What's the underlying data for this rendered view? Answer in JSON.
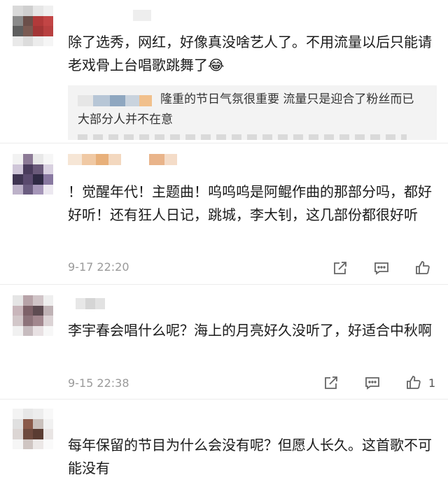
{
  "comments": [
    {
      "text": "除了选秀，网红，好像真没啥艺人了。不用流量以后只能请老戏骨上台唱歌跳舞了😂",
      "reply_quote": {
        "text": "隆重的节日气氛很重要 流量只是迎合了粉丝而已 大部分人并不在意"
      }
    },
    {
      "text": "！觉醒年代！主题曲！呜呜呜是阿鲲作曲的那部分吗，都好好听！还有狂人日记，跳城，李大钊，这几部份都很好听",
      "time": "9-17 22:20",
      "likes": ""
    },
    {
      "text": "李宇春会唱什么呢？海上的月亮好久没听了，好适合中秋啊",
      "time": "9-15 22:38",
      "likes": "1"
    },
    {
      "text": "每年保留的节目为什么会没有呢？但愿人长久。这首歌不可能没有"
    }
  ],
  "icons": {
    "share": "share-icon",
    "comment": "comment-icon",
    "like": "thumbs-up-icon"
  },
  "colors": {
    "background": "#ffffff",
    "text": "#1a1a1a",
    "meta": "#9a9a9a",
    "quote_bg": "#f3f3f3",
    "icon": "#666666"
  }
}
